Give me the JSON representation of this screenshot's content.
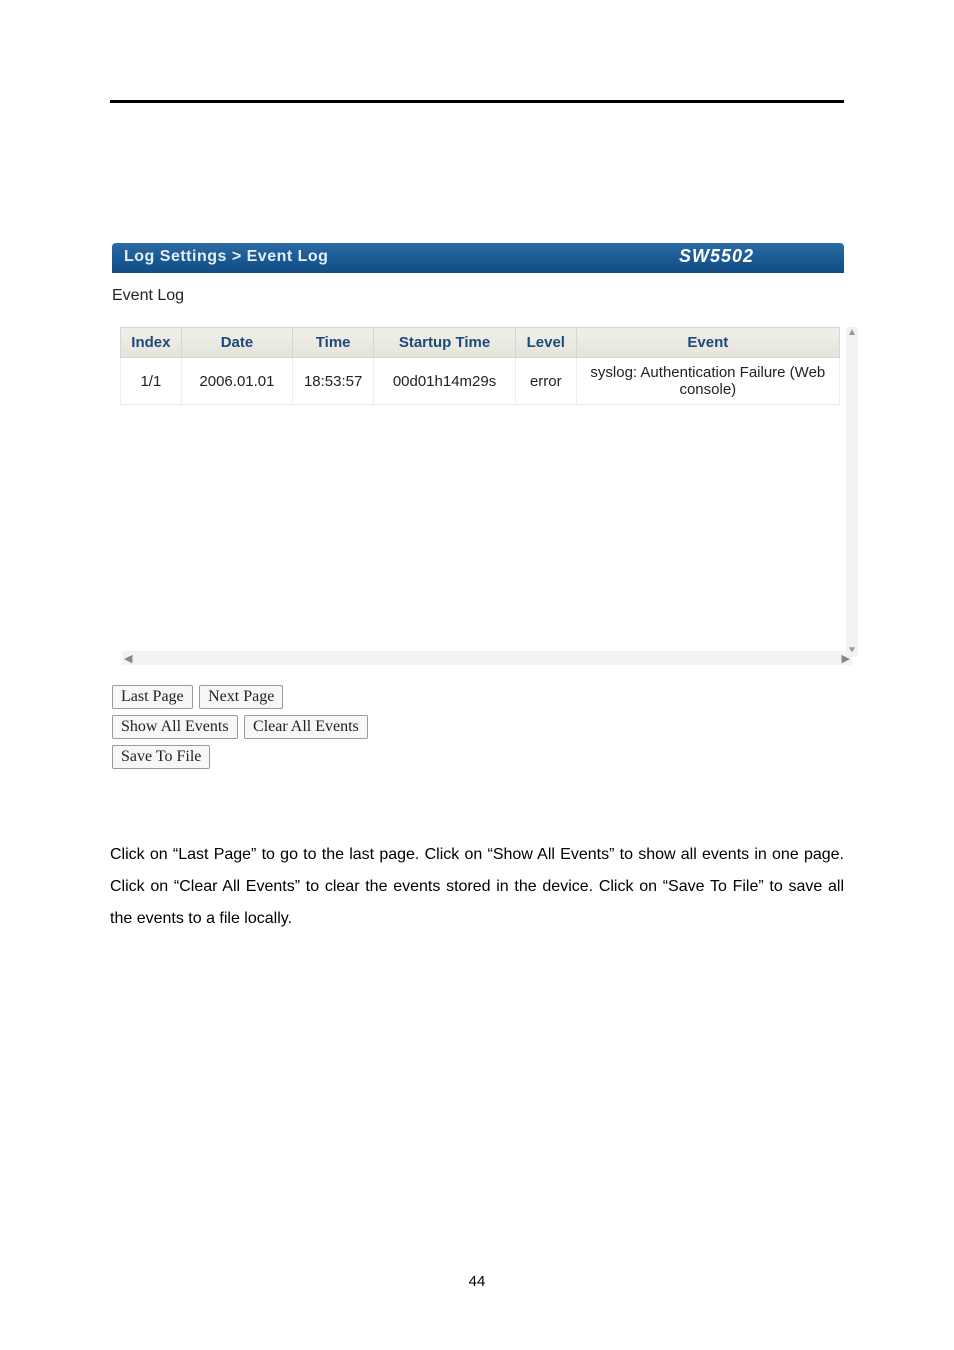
{
  "header": {
    "breadcrumb": "Log Settings > Event Log",
    "device": "SW5502"
  },
  "section_title": "Event Log",
  "table": {
    "headers": {
      "index": "Index",
      "date": "Date",
      "time": "Time",
      "startup": "Startup Time",
      "level": "Level",
      "event": "Event"
    },
    "rows": [
      {
        "index": "1/1",
        "date": "2006.01.01",
        "time": "18:53:57",
        "startup": "00d01h14m29s",
        "level": "error",
        "event": "syslog: Authentication Failure (Web console)"
      }
    ]
  },
  "buttons": {
    "last_page": "Last Page",
    "next_page": "Next Page",
    "show_all": "Show All Events",
    "clear_all": "Clear All Events",
    "save": "Save To File"
  },
  "description": "Click on “Last Page” to go to the last page. Click on “Show All Events” to show all events in one page. Click on “Clear All Events” to clear the events stored in the device. Click on “Save To File” to save all the events to a file locally.",
  "page_number": "44",
  "icons": {
    "scroll_up": "▲",
    "scroll_down": "▼",
    "scroll_left": "◀",
    "scroll_right": "▶"
  }
}
